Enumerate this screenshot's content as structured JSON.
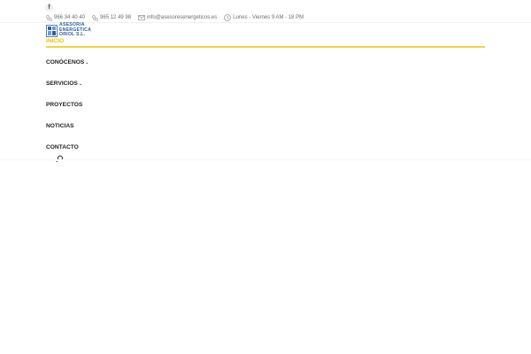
{
  "topbar": {
    "social": {
      "icon": "facebook-icon",
      "glyph": "f"
    },
    "contacts": [
      {
        "icon": "phone-icon",
        "text": "966 34 40 40"
      },
      {
        "icon": "phone-icon",
        "text": "965 12 49 98"
      },
      {
        "icon": "mail-icon",
        "text": "info@asesoresenergeticos.es"
      },
      {
        "icon": "clock-icon",
        "text": "Lunes - Viernes 9 AM - 18 PM"
      }
    ]
  },
  "logo": {
    "line1": "ASESORIA",
    "line2": "ENERGETICA",
    "line3": "ORIOL S.L."
  },
  "nav": {
    "items": [
      {
        "label": "INICIO",
        "active": true
      },
      {
        "label": "CONÓCENOS",
        "has_submenu": true
      },
      {
        "label": "SERVICIOS",
        "has_submenu": true
      },
      {
        "label": "PROYECTOS"
      },
      {
        "label": "NOTICIAS"
      },
      {
        "label": "CONTACTO"
      }
    ],
    "search_icon": "search-icon"
  },
  "colors": {
    "accent": "#f2c200",
    "logo_blue": "#2f5e9a",
    "text": "#222222"
  }
}
